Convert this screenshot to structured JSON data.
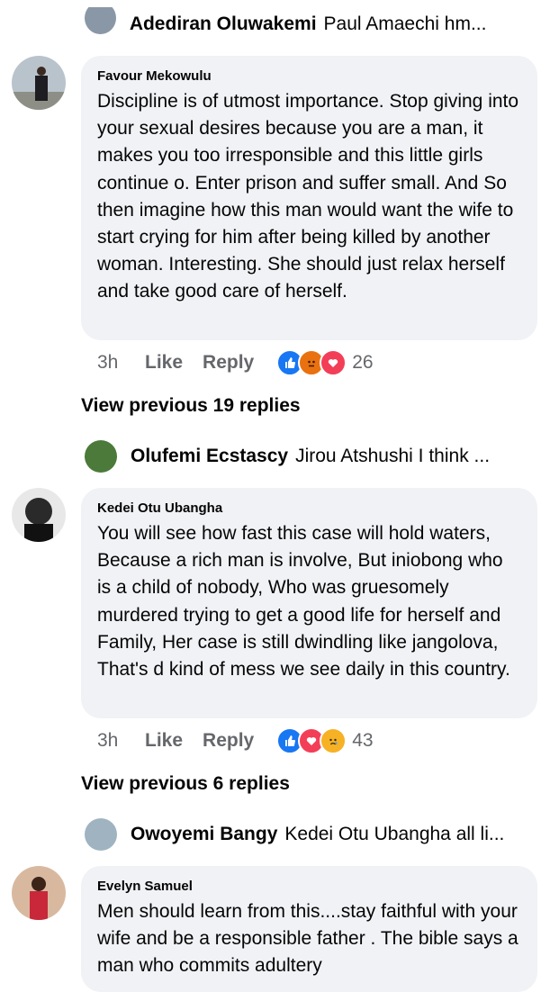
{
  "reply_preview_top": {
    "name": "Adediran Oluwakemi",
    "text": "Paul Amaechi hm..."
  },
  "comments": [
    {
      "author": "Favour Mekowulu",
      "text": "Discipline is of utmost importance. Stop giving into your sexual desires because you are a man, it makes you too irresponsible and this little girls continue o. Enter prison and suffer small. And So then imagine how this man would want the wife to start crying for him after being killed by another woman. Interesting. She should just relax herself and take good care of herself.",
      "time": "3h",
      "like_label": "Like",
      "reply_label": "Reply",
      "reactions": [
        "like",
        "angry",
        "love"
      ],
      "reaction_count": "26",
      "view_previous": "View previous 19 replies",
      "reply_preview": {
        "name": "Olufemi Ecstascy",
        "text": "Jirou Atshushi I think ..."
      }
    },
    {
      "author": "Kedei Otu Ubangha",
      "text": "You will see how fast this case will hold waters,  Because a rich man is involve, But iniobong who is a child of nobody, Who was gruesomely murdered trying to get a good life for herself and Family, Her case is still dwindling like jangolova, That's d kind of mess we see daily in this country.",
      "time": "3h",
      "like_label": "Like",
      "reply_label": "Reply",
      "reactions": [
        "like",
        "love",
        "sad"
      ],
      "reaction_count": "43",
      "view_previous": "View previous 6 replies",
      "reply_preview": {
        "name": "Owoyemi Bangy",
        "text": "Kedei Otu Ubangha all li..."
      }
    },
    {
      "author": "Evelyn Samuel",
      "text": "Men should learn from this....stay faithful with your wife and be a responsible father . The bible says  a man who commits adultery"
    }
  ],
  "colors": {
    "like": "#1877f2",
    "love": "#f33e58",
    "angry": "#e9710f",
    "sad": "#f7b125",
    "bubble": "#f0f2f5",
    "meta": "#65676b"
  }
}
